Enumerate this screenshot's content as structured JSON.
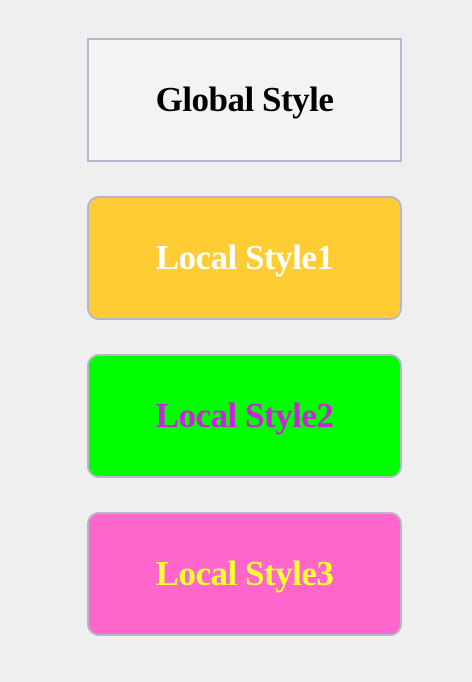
{
  "buttons": {
    "global": {
      "label": "Global Style",
      "bg": "#f1f4f2",
      "fg": "#000000"
    },
    "local1": {
      "label": "Local Style1",
      "bg": "#ffcc33",
      "fg": "#ffffff"
    },
    "local2": {
      "label": "Local Style2",
      "bg": "#00ff00",
      "fg": "#cc22dd"
    },
    "local3": {
      "label": "Local Style3",
      "bg": "#ff66cc",
      "fg": "#ffff33"
    }
  }
}
